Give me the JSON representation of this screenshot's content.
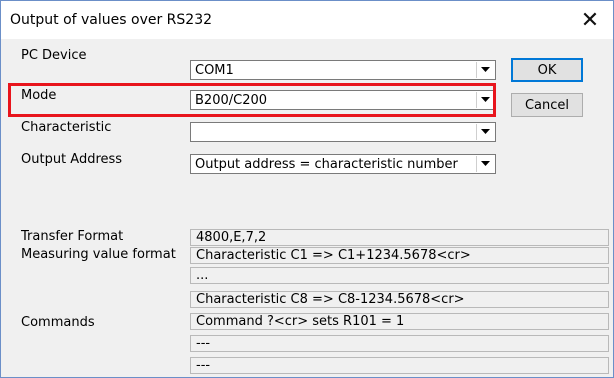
{
  "window": {
    "title": "Output of values over RS232"
  },
  "fields": {
    "pc_device": {
      "label": "PC Device",
      "value": "COM1"
    },
    "mode": {
      "label": "Mode",
      "value": "B200/C200"
    },
    "characteristic": {
      "label": "Characteristic",
      "value": ""
    },
    "output_address": {
      "label": "Output Address",
      "value": "Output address = characteristic number"
    }
  },
  "buttons": {
    "ok": "OK",
    "cancel": "Cancel"
  },
  "info": {
    "transfer_format_label": "Transfer Format",
    "measuring_value_format_label": "Measuring value format",
    "commands_label": "Commands",
    "lines": [
      "4800,E,7,2",
      "Characteristic C1     =>  C1+1234.5678<cr>",
      "...",
      "Characteristic C8     =>  C8-1234.5678<cr>",
      "Command  ?<cr>  sets R101 = 1",
      "---",
      "---"
    ]
  },
  "highlight_color": "#e8141c"
}
